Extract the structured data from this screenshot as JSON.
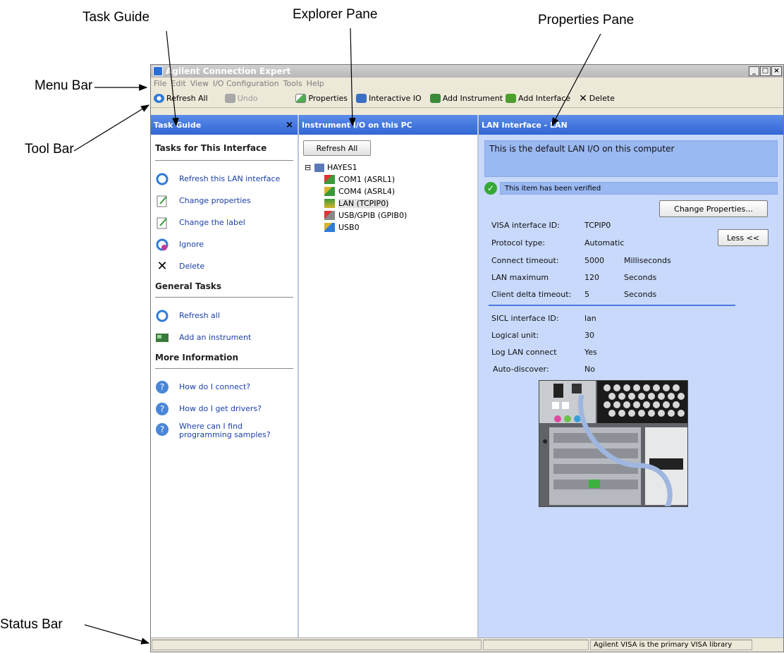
{
  "callouts": {
    "task_guide": "Task Guide",
    "explorer_pane": "Explorer Pane",
    "properties_pane": "Properties Pane",
    "menu_bar": "Menu Bar",
    "tool_bar": "Tool Bar",
    "status_bar": "Status Bar"
  },
  "window": {
    "title": "Agilent Connection Expert",
    "controls": [
      "_",
      "□",
      "×"
    ]
  },
  "menu": [
    "File",
    "Edit",
    "View",
    "I/O Configuration",
    "Tools",
    "Help"
  ],
  "toolbar": {
    "refresh_all": "Refresh All",
    "undo": "Undo",
    "properties": "Properties",
    "interactive_io": "Interactive IO",
    "add_instrument": "Add Instrument",
    "add_interface": "Add Interface",
    "delete": "Delete"
  },
  "task_guide": {
    "header": "Task Guide",
    "close": "×",
    "section1": "Tasks for This Interface",
    "tasks1": [
      "Refresh this LAN interface",
      "Change properties",
      "Change the label",
      "Ignore",
      "Delete"
    ],
    "section2": "General Tasks",
    "tasks2": [
      "Refresh all",
      "Add an instrument"
    ],
    "section3": "More Information",
    "tasks3": [
      "How do I connect?",
      "How do I get drivers?",
      "Where can I find programming samples?"
    ]
  },
  "explorer": {
    "header": "Instrument I/O on this PC",
    "refresh_button": "Refresh All",
    "root": "HAYES1",
    "root_toggle": "⊟",
    "items": [
      "COM1 (ASRL1)",
      "COM4 (ASRL4)",
      "LAN (TCPIP0)",
      "USB/GPIB (GPIB0)",
      "USB0"
    ]
  },
  "properties": {
    "header": "LAN Interface - LAN",
    "description": "This is the default LAN I/O on this computer",
    "verified": "This item has been verified",
    "change_button": "Change Properties...",
    "less_button": "Less <<",
    "rows_visa": [
      {
        "k": "VISA interface ID:",
        "v": "TCPIP0",
        "u": ""
      },
      {
        "k": "Protocol type:",
        "v": "Automatic",
        "u": ""
      },
      {
        "k": "Connect timeout:",
        "v": "5000",
        "u": "Milliseconds"
      },
      {
        "k": "LAN maximum",
        "v": "120",
        "u": "Seconds"
      },
      {
        "k": "Client delta timeout:",
        "v": "5",
        "u": "Seconds"
      }
    ],
    "rows_sicl": [
      {
        "k": "SICL interface ID:",
        "v": "lan"
      },
      {
        "k": "Logical unit:",
        "v": "30"
      },
      {
        "k": "Log LAN connect",
        "v": "Yes"
      },
      {
        "k": "Auto-discover:",
        "v": "No"
      }
    ]
  },
  "status": {
    "message": "Agilent VISA is the primary VISA library"
  }
}
